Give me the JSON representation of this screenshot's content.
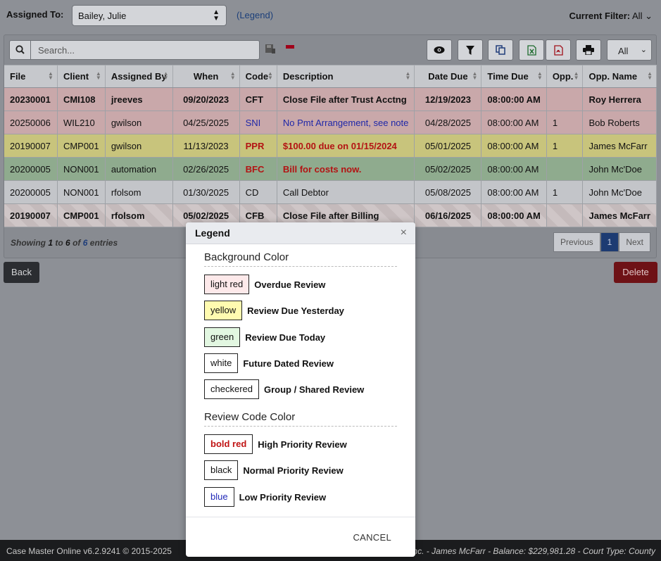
{
  "header": {
    "assigned_label": "Assigned To:",
    "assigned_value": "Bailey, Julie",
    "legend_link": "(Legend)",
    "filter_label": "Current Filter:",
    "filter_value": "All"
  },
  "toolbar": {
    "search_placeholder": "Search...",
    "length_value": "All"
  },
  "table": {
    "columns": [
      "File",
      "Client",
      "Assigned By",
      "When",
      "Code",
      "Description",
      "Date Due",
      "Time Due",
      "Opp.",
      "Opp. Name"
    ],
    "rows": [
      {
        "file": "20230001",
        "client": "CMI108",
        "by": "jreeves",
        "when": "09/20/2023",
        "code": "CFT",
        "desc": "Close File after Trust Acctng",
        "due": "12/19/2023",
        "time": "08:00:00 AM",
        "opp": "",
        "name": "Roy Herrera"
      },
      {
        "file": "20250006",
        "client": "WIL210",
        "by": "gwilson",
        "when": "04/25/2025",
        "code": "SNI",
        "desc": "No Pmt Arrangement, see note",
        "due": "04/28/2025",
        "time": "08:00:00 AM",
        "opp": "1",
        "name": "Bob Roberts"
      },
      {
        "file": "20190007",
        "client": "CMP001",
        "by": "gwilson",
        "when": "11/13/2023",
        "code": "PPR",
        "desc": "$100.00 due on 01/15/2024",
        "due": "05/01/2025",
        "time": "08:00:00 AM",
        "opp": "1",
        "name": "James McFarr"
      },
      {
        "file": "20200005",
        "client": "NON001",
        "by": "automation",
        "when": "02/26/2025",
        "code": "BFC",
        "desc": "Bill for costs now.",
        "due": "05/02/2025",
        "time": "08:00:00 AM",
        "opp": "",
        "name": "John Mc'Doe"
      },
      {
        "file": "20200005",
        "client": "NON001",
        "by": "rfolsom",
        "when": "01/30/2025",
        "code": "CD",
        "desc": "Call Debtor",
        "due": "05/08/2025",
        "time": "08:00:00 AM",
        "opp": "1",
        "name": "John Mc'Doe"
      },
      {
        "file": "20190007",
        "client": "CMP001",
        "by": "rfolsom",
        "when": "05/02/2025",
        "code": "CFB",
        "desc": "Close File after Billing",
        "due": "06/16/2025",
        "time": "08:00:00 AM",
        "opp": "",
        "name": "James McFarr"
      }
    ]
  },
  "info": {
    "showing": "Showing",
    "from": "1",
    "to_word": "to",
    "to": "6",
    "of_word": "of",
    "total": "6",
    "entries": "entries"
  },
  "pager": {
    "previous": "Previous",
    "page": "1",
    "next": "Next"
  },
  "buttons": {
    "back": "Back",
    "delete": "Delete"
  },
  "footer": {
    "left": "Case Master Online v6.2.9241 © 2015-2025",
    "right": "Inc. - James McFarr - Balance: $229,981.28 - Court Type: County"
  },
  "modal": {
    "title": "Legend",
    "close": "×",
    "bg_section": "Background Color",
    "bg_items": [
      {
        "swatch": "light red",
        "label": "Overdue Review"
      },
      {
        "swatch": "yellow",
        "label": "Review Due Yesterday"
      },
      {
        "swatch": "green",
        "label": "Review Due Today"
      },
      {
        "swatch": "white",
        "label": "Future Dated Review"
      },
      {
        "swatch": "checkered",
        "label": "Group / Shared Review"
      }
    ],
    "code_section": "Review Code Color",
    "code_items": [
      {
        "swatch": "bold red",
        "label": "High Priority Review"
      },
      {
        "swatch": "black",
        "label": "Normal Priority Review"
      },
      {
        "swatch": "blue",
        "label": "Low Priority Review"
      }
    ],
    "cancel": "CANCEL"
  },
  "colors": {
    "overdue_bg": "#fde9ea",
    "yesterday_bg": "#fffbb0",
    "today_bg": "#e2f7e1",
    "high_priority": "#c01414",
    "low_priority": "#2129b8",
    "delete_button": "#8b1a20"
  },
  "icons": {
    "search": "search-icon",
    "save": "save-filter-icon",
    "remove": "remove-filter-icon",
    "view": "eye-icon",
    "filter": "filter-icon",
    "copy": "copy-icon",
    "excel": "excel-icon",
    "pdf": "pdf-icon",
    "print": "print-icon"
  }
}
